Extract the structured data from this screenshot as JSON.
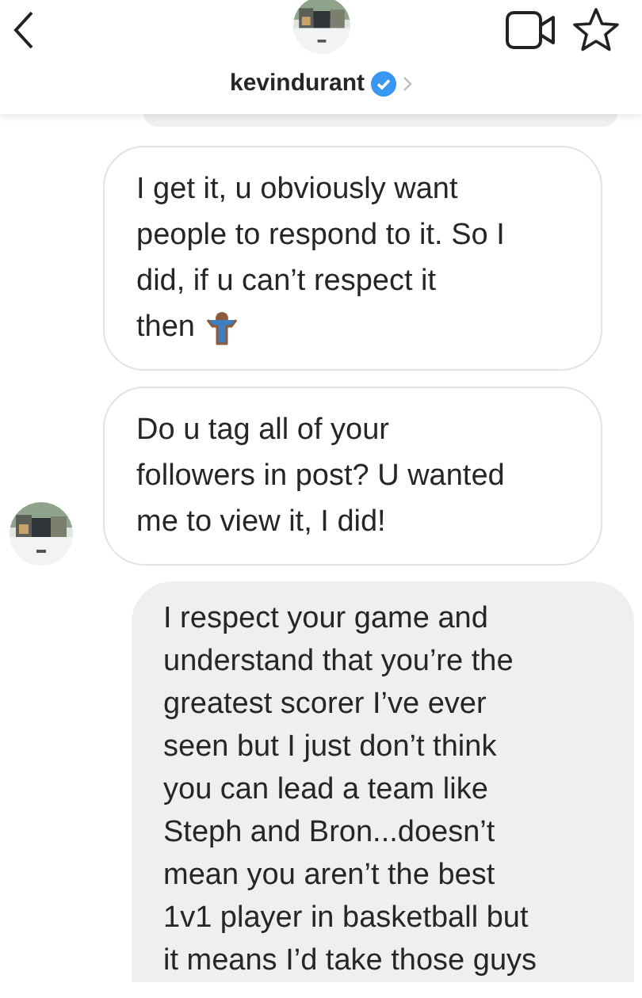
{
  "header": {
    "username": "kevindurant",
    "verified": true
  },
  "messages": [
    {
      "kind": "clipped"
    },
    {
      "kind": "received",
      "text": "I get it, u obviously want\npeople to respond to it. So I\ndid, if u can’t respect it\nthen",
      "emoji": true,
      "avatar": false
    },
    {
      "kind": "received",
      "text": "Do u tag all of your\nfollowers in post? U wanted\nme to view it, I did!",
      "emoji": false,
      "avatar": true
    },
    {
      "kind": "sent",
      "text": "I respect your game and\nunderstand that you’re the\ngreatest scorer I’ve ever\nseen but I just don’t think\nyou can lead a team like\nSteph and Bron...doesn’t\nmean you aren’t the best\n1v1 player in basketball but\nit means I’d take those guys"
    }
  ]
}
